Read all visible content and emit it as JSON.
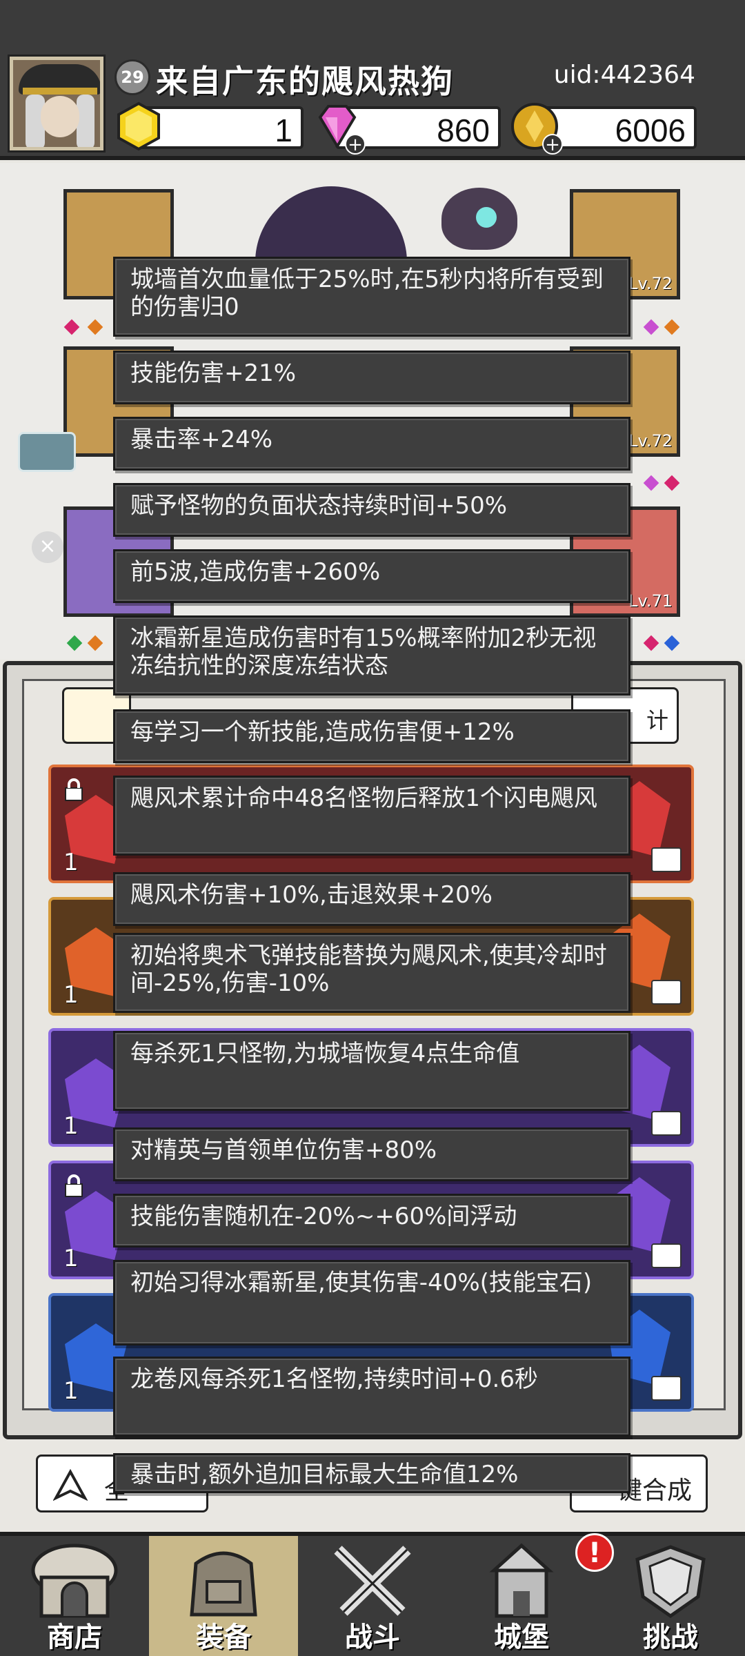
{
  "header": {
    "level": "29",
    "player_name": "来自广东的飓风热狗",
    "uid": "uid:442364",
    "resources": [
      {
        "icon": "gold-gem-icon",
        "value": "1"
      },
      {
        "icon": "pink-diamond-icon",
        "value": "860"
      },
      {
        "icon": "gold-coin-icon",
        "value": "6006"
      }
    ]
  },
  "equipment": {
    "slots": [
      {
        "name": "helmet",
        "level": ""
      },
      {
        "name": "weapon-right",
        "level": "Lv.72"
      },
      {
        "name": "armor-left",
        "level": ""
      },
      {
        "name": "armor-right",
        "level": "Lv.72"
      },
      {
        "name": "boots-left",
        "level": ""
      },
      {
        "name": "ring-right",
        "level": "Lv.71"
      }
    ]
  },
  "bag": {
    "stats_button": "计",
    "rows": [
      {
        "count": "1",
        "locked": true,
        "color": "#d73a3a",
        "frame": "#c84d2a"
      },
      {
        "count": "1",
        "locked": false,
        "color": "#e0622a",
        "frame": "#b9782a"
      },
      {
        "count": "1",
        "locked": false,
        "color": "#7b4bd0",
        "frame": "#6a45b8"
      },
      {
        "count": "1",
        "locked": true,
        "color": "#7b4bd0",
        "frame": "#6a45b8"
      },
      {
        "count": "1",
        "locked": false,
        "color": "#2f66d8",
        "frame": "#2f5aa8"
      }
    ],
    "left_action": "全",
    "right_action": "键合成"
  },
  "tooltips": [
    "城墙首次血量低于25%时,在5秒内将所有受到的伤害归0",
    "技能伤害+21%",
    "暴击率+24%",
    "赋予怪物的负面状态持续时间+50%",
    "前5波,造成伤害+260%",
    "冰霜新星造成伤害时有15%概率附加2秒无视冻结抗性的深度冻结状态",
    "每学习一个新技能,造成伤害便+12%",
    "飓风术累计命中48名怪物后释放1个闪电飓风",
    "飓风术伤害+10%,击退效果+20%",
    "初始将奥术飞弹技能替换为飓风术,使其冷却时间-25%,伤害-10%",
    "每杀死1只怪物,为城墙恢复4点生命值",
    "对精英与首领单位伤害+80%",
    "技能伤害随机在-20%~+60%间浮动",
    "初始习得冰霜新星,使其伤害-40%(技能宝石)",
    "龙卷风每杀死1名怪物,持续时间+0.6秒",
    "暴击时,额外追加目标最大生命值12%"
  ],
  "nav": {
    "items": [
      {
        "label": "商店",
        "icon": "shop-icon"
      },
      {
        "label": "装备",
        "icon": "backpack-icon"
      },
      {
        "label": "战斗",
        "icon": "crossed-swords-icon"
      },
      {
        "label": "城堡",
        "icon": "castle-icon"
      },
      {
        "label": "挑战",
        "icon": "challenge-shield-icon"
      }
    ],
    "alert": "!"
  }
}
